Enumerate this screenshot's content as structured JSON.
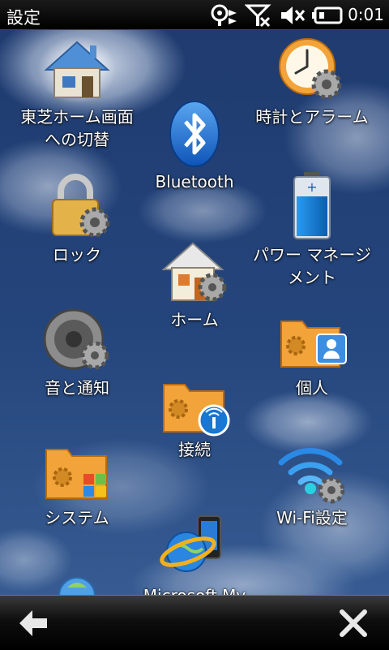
{
  "status_bar": {
    "title": "設定",
    "time": "0:01",
    "icons": [
      "sync-icon",
      "signal-off-icon",
      "volume-muted-icon",
      "battery-icon"
    ]
  },
  "tiles": [
    {
      "id": "toshiba-home",
      "label": "東芝ホーム画面\nへの切替",
      "icon": "house-glow-icon"
    },
    {
      "id": "bluetooth",
      "label": "Bluetooth",
      "icon": "bluetooth-icon"
    },
    {
      "id": "clock-alarm",
      "label": "時計とアラーム",
      "icon": "clock-gear-icon"
    },
    {
      "id": "lock",
      "label": "ロック",
      "icon": "padlock-gear-icon"
    },
    {
      "id": "home",
      "label": "ホーム",
      "icon": "house-gear-icon"
    },
    {
      "id": "power",
      "label": "パワー マネージ\nメント",
      "icon": "battery-icon"
    },
    {
      "id": "sound",
      "label": "音と通知",
      "icon": "speaker-gear-icon"
    },
    {
      "id": "connections",
      "label": "接続",
      "icon": "folder-antenna-icon"
    },
    {
      "id": "personal",
      "label": "個人",
      "icon": "folder-person-icon"
    },
    {
      "id": "system",
      "label": "システム",
      "icon": "folder-windows-icon"
    },
    {
      "id": "wifi",
      "label": "Wi-Fi設定",
      "icon": "wifi-gear-icon"
    },
    {
      "id": "my-phone",
      "label": "Microsoft My",
      "icon": "globe-phone-icon"
    },
    {
      "id": "partial",
      "label": "",
      "icon": "globe-partial-icon"
    }
  ],
  "bottom_bar": {
    "back_icon": "back-arrow-icon",
    "close_icon": "close-icon"
  },
  "colors": {
    "sky": "#1c3563",
    "folder": "#f2a43a",
    "gear": "#9a9a9a",
    "battery": "#1e8ee6"
  }
}
